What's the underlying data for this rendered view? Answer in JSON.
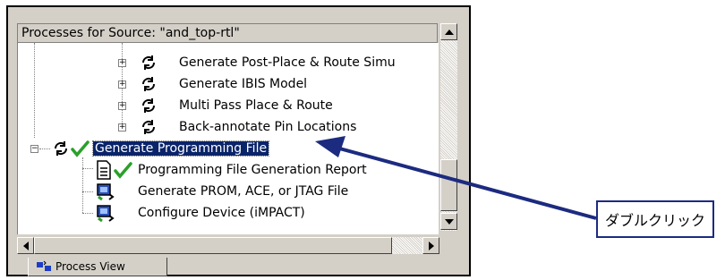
{
  "panel": {
    "header_title": "Processes for Source: \"and_top-rtl\""
  },
  "tree": {
    "items": [
      {
        "label": "Generate Post-Place & Route Simu",
        "icon": "refresh-icon"
      },
      {
        "label": "Generate IBIS Model",
        "icon": "refresh-icon"
      },
      {
        "label": "Multi Pass Place & Route",
        "icon": "refresh-icon"
      },
      {
        "label": "Back-annotate Pin Locations",
        "icon": "refresh-icon"
      },
      {
        "label": "Generate Programming File",
        "icon": "refresh-check-icon",
        "selected": true
      },
      {
        "label": "Programming File Generation Report",
        "icon": "report-check-icon"
      },
      {
        "label": "Generate PROM, ACE, or JTAG File",
        "icon": "chip-icon"
      },
      {
        "label": "Configure Device (iMPACT)",
        "icon": "chip-icon"
      }
    ]
  },
  "tab": {
    "label": "Process View"
  },
  "callout": {
    "label": "ダブルクリック"
  },
  "colors": {
    "selection": "#0a246a",
    "check": "#2aa02a",
    "arrow": "#1c2b80"
  }
}
